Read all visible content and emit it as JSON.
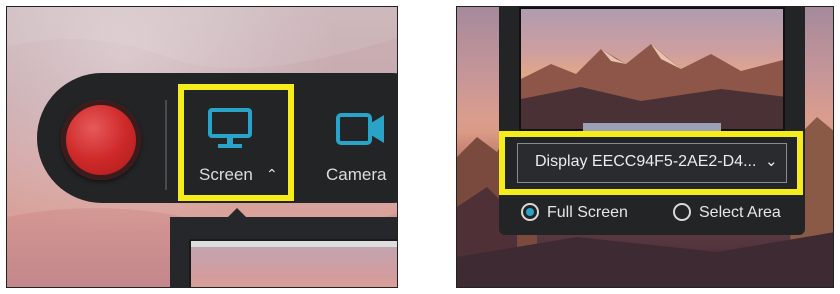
{
  "left_panel": {
    "screen_option_label": "Screen",
    "camera_option_label": "Camera",
    "accent_color": "#2aa3c9",
    "highlight_color": "#f4ec1b",
    "record_button_color": "#cf2a2a"
  },
  "right_panel": {
    "display_select_value": "Display EECC94F5-2AE2-D4...",
    "radio_full_screen_label": "Full Screen",
    "radio_select_area_label": "Select Area",
    "selected_mode": "Full Screen"
  },
  "icons": {
    "record": "record-icon",
    "screen": "monitor-icon",
    "screen_caret": "chevron-up-icon",
    "camera": "video-camera-icon",
    "display_chevron": "chevron-down-icon"
  }
}
